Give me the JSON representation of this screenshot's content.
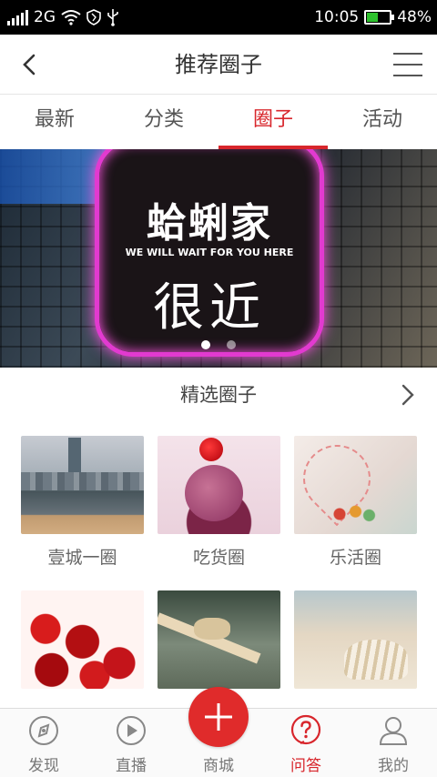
{
  "status_bar": {
    "network": "2G",
    "time": "10:05",
    "battery": "48%",
    "battery_level": 0.48,
    "battery_color": "#2ec12e"
  },
  "header": {
    "title": "推荐圈子",
    "back_icon": "chevron-left-icon",
    "menu_icon": "hamburger-menu-icon"
  },
  "tabs": [
    {
      "label": "最新",
      "active": false
    },
    {
      "label": "分类",
      "active": false
    },
    {
      "label": "圈子",
      "active": true
    },
    {
      "label": "活动",
      "active": false
    }
  ],
  "banner": {
    "sign_brand": "蛤蜊家",
    "sign_sub": "WE WILL WAIT FOR YOU HERE",
    "sign_near": "很近",
    "page_count": 2,
    "active_page": 1
  },
  "section": {
    "title": "精选圈子",
    "more_icon": "chevron-right-icon"
  },
  "circles": [
    {
      "label": "壹城一圈",
      "image": "city-skyline-photo"
    },
    {
      "label": "吃货圈",
      "image": "ice-cream-photo"
    },
    {
      "label": "乐活圈",
      "image": "paper-heart-photo"
    },
    {
      "label": "",
      "image": "cherries-photo"
    },
    {
      "label": "",
      "image": "bamboo-fountain-photo"
    },
    {
      "label": "",
      "image": "seashell-photo"
    }
  ],
  "bottom_nav": [
    {
      "label": "发现",
      "icon": "compass-icon",
      "active": false
    },
    {
      "label": "直播",
      "icon": "play-icon",
      "active": false
    },
    {
      "label": "商城",
      "icon": "plus-icon",
      "active": false
    },
    {
      "label": "问答",
      "icon": "question-icon",
      "active": true
    },
    {
      "label": "我的",
      "icon": "user-icon",
      "active": false
    }
  ],
  "colors": {
    "accent": "#d8262c",
    "text": "#333333",
    "muted": "#777777"
  }
}
